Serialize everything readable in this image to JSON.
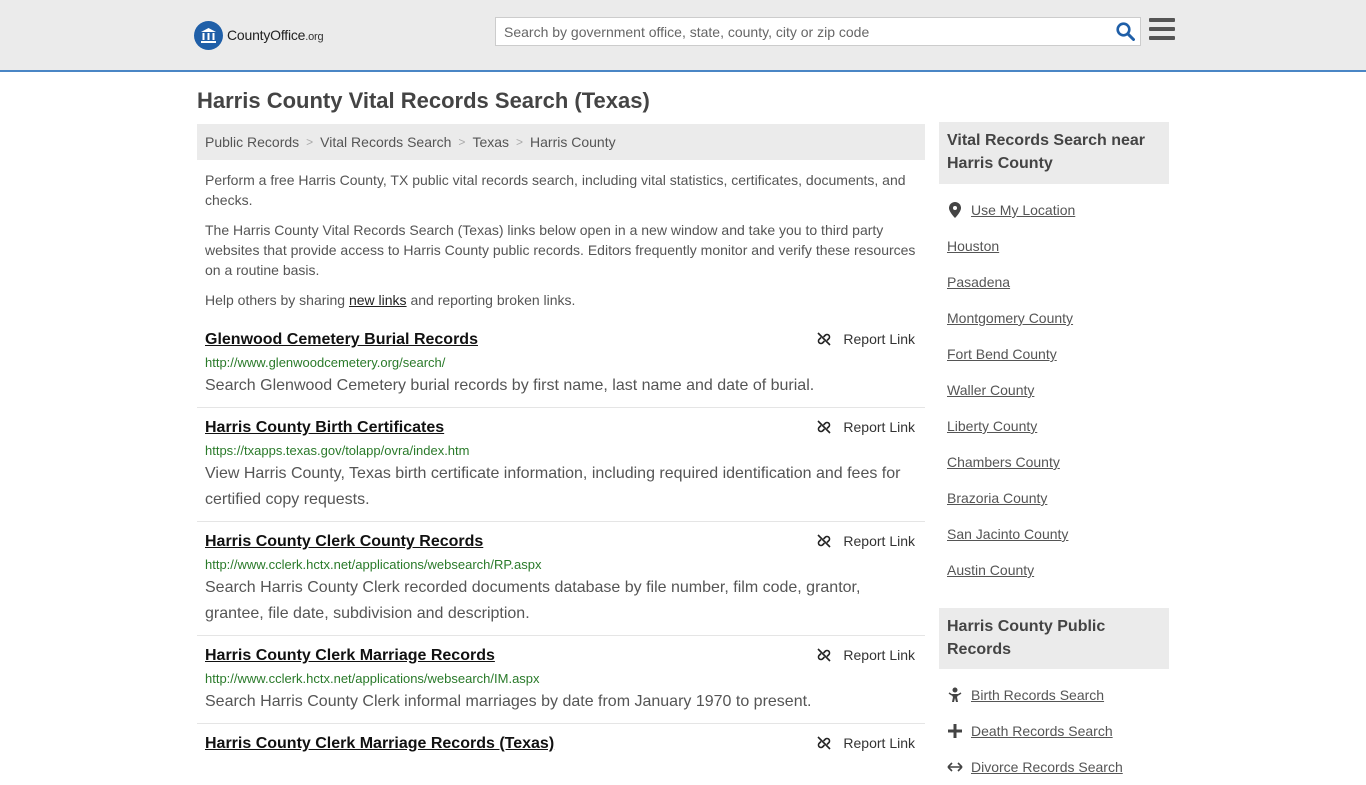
{
  "header": {
    "logo": {
      "brand": "CountyOffice",
      "tld": ".org"
    },
    "search": {
      "placeholder": "Search by government office, state, county, city or zip code"
    }
  },
  "page_title": "Harris County Vital Records Search (Texas)",
  "breadcrumb": [
    "Public Records",
    "Vital Records Search",
    "Texas",
    "Harris County"
  ],
  "intro": {
    "p1": "Perform a free Harris County, TX public vital records search, including vital statistics, certificates, documents, and checks.",
    "p2": "The Harris County Vital Records Search (Texas) links below open in a new window and take you to third party websites that provide access to Harris County public records. Editors frequently monitor and verify these resources on a routine basis.",
    "p3_before": "Help others by sharing ",
    "p3_link": "new links",
    "p3_after": " and reporting broken links."
  },
  "report_label": "Report Link",
  "records": [
    {
      "title": "Glenwood Cemetery Burial Records",
      "url": "http://www.glenwoodcemetery.org/search/",
      "desc": "Search Glenwood Cemetery burial records by first name, last name and date of burial."
    },
    {
      "title": "Harris County Birth Certificates",
      "url": "https://txapps.texas.gov/tolapp/ovra/index.htm",
      "desc": "View Harris County, Texas birth certificate information, including required identification and fees for certified copy requests."
    },
    {
      "title": "Harris County Clerk County Records",
      "url": "http://www.cclerk.hctx.net/applications/websearch/RP.aspx",
      "desc": "Search Harris County Clerk recorded documents database by file number, film code, grantor, grantee, file date, subdivision and description."
    },
    {
      "title": "Harris County Clerk Marriage Records",
      "url": "http://www.cclerk.hctx.net/applications/websearch/IM.aspx",
      "desc": "Search Harris County Clerk informal marriages by date from January 1970 to present."
    },
    {
      "title": "Harris County Clerk Marriage Records (Texas)",
      "url": "",
      "desc": ""
    }
  ],
  "sidebar": {
    "nearby_title": "Vital Records Search near Harris County",
    "use_location": "Use My Location",
    "nearby": [
      "Houston",
      "Pasadena",
      "Montgomery County",
      "Fort Bend County",
      "Waller County",
      "Liberty County",
      "Chambers County",
      "Brazoria County",
      "San Jacinto County",
      "Austin County"
    ],
    "public_title": "Harris County Public Records",
    "public_items": [
      {
        "label": "Birth Records Search",
        "icon": "baby-icon"
      },
      {
        "label": "Death Records Search",
        "icon": "cross-icon"
      },
      {
        "label": "Divorce Records Search",
        "icon": "arrows-icon"
      }
    ]
  },
  "colors": {
    "header_bg": "#ebebeb",
    "header_border": "#4a86c5",
    "url_green": "#2a7a2a",
    "brand_blue": "#1f5fa8"
  }
}
